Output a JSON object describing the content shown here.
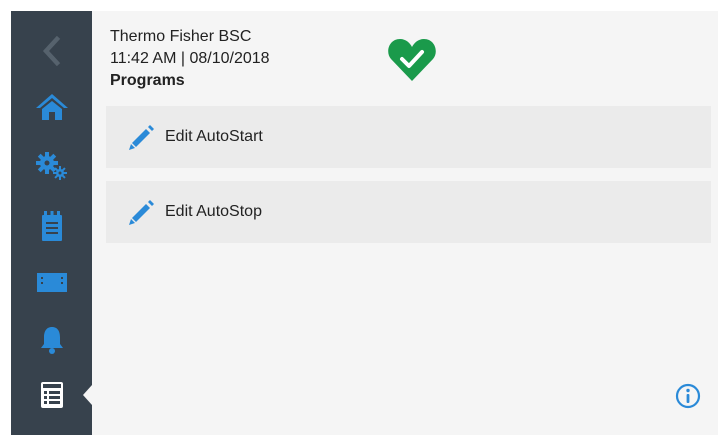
{
  "header": {
    "device_name": "Thermo Fisher BSC",
    "datetime": "11:42  AM | 08/10/2018",
    "page_title": "Programs"
  },
  "status": {
    "icon": "heart-check-icon",
    "state": "ok",
    "color": "#1a9a4b"
  },
  "programs": [
    {
      "label": "Edit AutoStart",
      "icon": "pencil-icon"
    },
    {
      "label": "Edit AutoStop",
      "icon": "pencil-icon"
    }
  ],
  "sidebar": {
    "items": [
      {
        "icon": "chevron-left-icon",
        "name": "back"
      },
      {
        "icon": "home-icon",
        "name": "home"
      },
      {
        "icon": "gears-icon",
        "name": "settings"
      },
      {
        "icon": "clipboard-icon",
        "name": "log"
      },
      {
        "icon": "display-icon",
        "name": "display"
      },
      {
        "icon": "bell-icon",
        "name": "alarms"
      },
      {
        "icon": "programs-icon",
        "name": "programs",
        "active": true
      }
    ]
  },
  "colors": {
    "sidebar_bg": "#37424d",
    "accent_blue": "#2a8ad8",
    "content_bg": "#f5f5f5",
    "row_bg": "#ebebeb"
  }
}
